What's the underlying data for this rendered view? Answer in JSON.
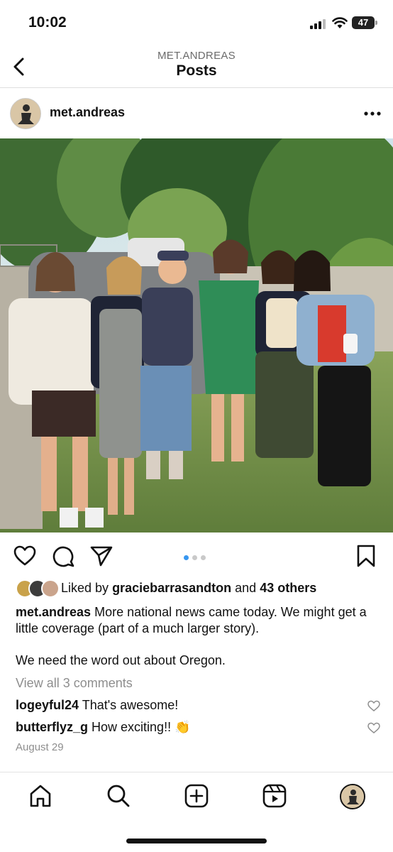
{
  "status_bar": {
    "time": "10:02",
    "battery": "47"
  },
  "header": {
    "username": "MET.ANDREAS",
    "title": "Posts"
  },
  "post": {
    "username": "met.andreas",
    "carousel": {
      "count": 3,
      "active": 1
    },
    "likes": {
      "prefix": "Liked by",
      "user": "graciebarrasandton",
      "conj": "and",
      "others": "43 others"
    },
    "caption": {
      "user": "met.andreas",
      "text": "More national news came today.  We might get a little coverage (part of a much larger story).",
      "text2": "We need the word out about Oregon."
    },
    "view_all": "View all 3 comments",
    "comments": [
      {
        "user": "logeyful24",
        "text": "That's awesome!"
      },
      {
        "user": "butterflyz_g",
        "text": "How exciting!! 👏"
      }
    ],
    "date": "August 29"
  },
  "icons": {
    "back": "chevron-left-icon",
    "more": "more-horizontal-icon",
    "like": "heart-icon",
    "comment": "comment-icon",
    "share": "send-icon",
    "save": "bookmark-icon",
    "home": "home-icon",
    "search": "search-icon",
    "create": "plus-square-icon",
    "reels": "reels-icon"
  },
  "colors": {
    "accent": "#3897f0",
    "muted": "#8e8e8e"
  }
}
